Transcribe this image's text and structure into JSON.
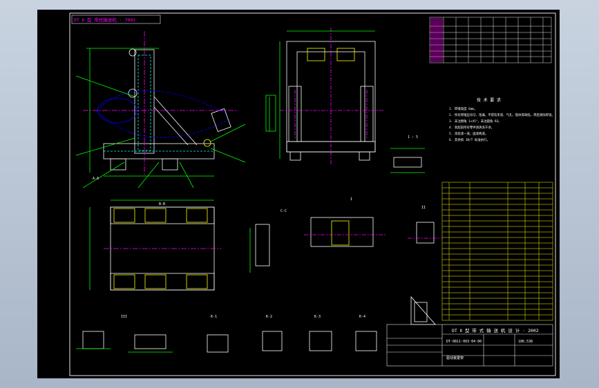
{
  "drawing": {
    "header_banner": "DT Ⅱ 型 带式输送机 · 7002",
    "main_view_title": "DT Ⅱ 型 带 式 输 送 机 设 计 · 2002",
    "section_labels": [
      "A-A",
      "B-B",
      "C-C",
      "I",
      "II",
      "III",
      "K-1",
      "K-2",
      "K-3",
      "K-4"
    ],
    "scale_label": "1 : 5",
    "tech_requirements_title": "技 术 要 求",
    "tech_requirements": [
      "1. 焊缝高度 6mm。",
      "2. 所有焊缝应均匀、饱满，不得有夹渣、气孔、裂纹等缺陷，焊后清除焊渣。",
      "3. 未注倒角 1×45°，未注圆角 R3。",
      "4. 装配前所有零件须清洗干净。",
      "5. 涂底漆一道，面漆两道。",
      "6. 其余按 JB/T 标准执行。"
    ],
    "title_block": {
      "project": "DT Ⅱ 型 带 式 输 送 机 设 计 · 2002",
      "drawing_no": "DT·0811·003·04·00",
      "part_name": "驱动装置架",
      "weight": "186.538",
      "scale": "1:5"
    },
    "colors": {
      "background": "#000000",
      "frame": "#e8e8e8",
      "outline": "#ffffff",
      "hidden": "#00ffff",
      "centerline": "#ff00ff",
      "dimension": "#00ff00",
      "highlight": "#ffff00",
      "table_header": "#ff00ff"
    }
  }
}
